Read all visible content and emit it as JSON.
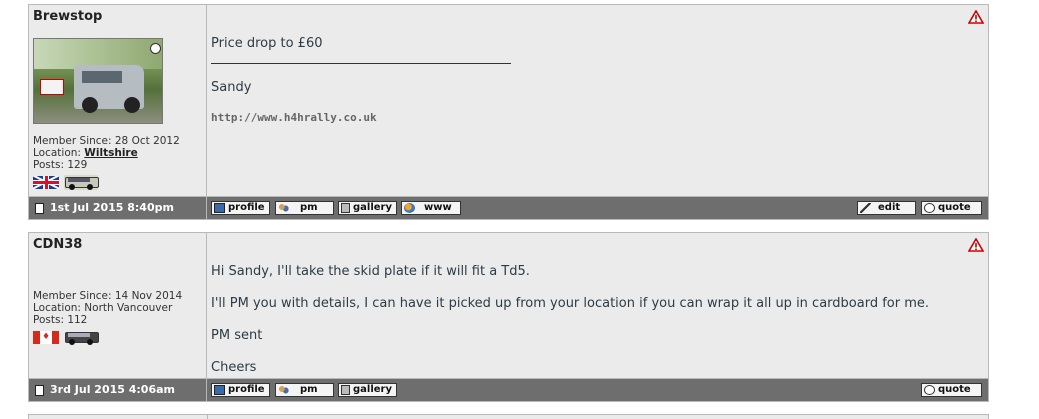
{
  "posts": [
    {
      "author": "Brewstop",
      "member_since": "Member Since: 28 Oct 2012",
      "location_label": "Location: ",
      "location": "Wiltshire",
      "posts": "Posts: 129",
      "flag": "uk-flag-icon",
      "content": {
        "line1": "Price drop to £60",
        "sig_name": "Sandy",
        "sig_link": "http://www.h4hrally.co.uk"
      },
      "date": "1st Jul 2015 8:40pm",
      "buttons_left": [
        "profile",
        "pm",
        "gallery",
        "www"
      ],
      "buttons_right": [
        "edit",
        "quote"
      ]
    },
    {
      "author": "CDN38",
      "member_since": "Member Since: 14 Nov 2014",
      "location": "Location: North Vancouver",
      "posts": "Posts: 112",
      "flag": "canada-flag-icon",
      "content": {
        "line1": "Hi Sandy, I'll take the skid plate if it will fit a Td5.",
        "line2": "I'll PM you with details, I can have it picked up from your location if you can wrap it all up in cardboard for me.",
        "line3": "PM sent",
        "line4": "Cheers"
      },
      "date": "3rd Jul 2015 4:06am",
      "buttons_left": [
        "profile",
        "pm",
        "gallery"
      ],
      "buttons_right": [
        "quote"
      ]
    }
  ],
  "colors": {
    "post_bg": "#ebebeb",
    "bar_bg": "#6e6e6e",
    "warning": "#cc0000",
    "text": "#2d3b46"
  }
}
